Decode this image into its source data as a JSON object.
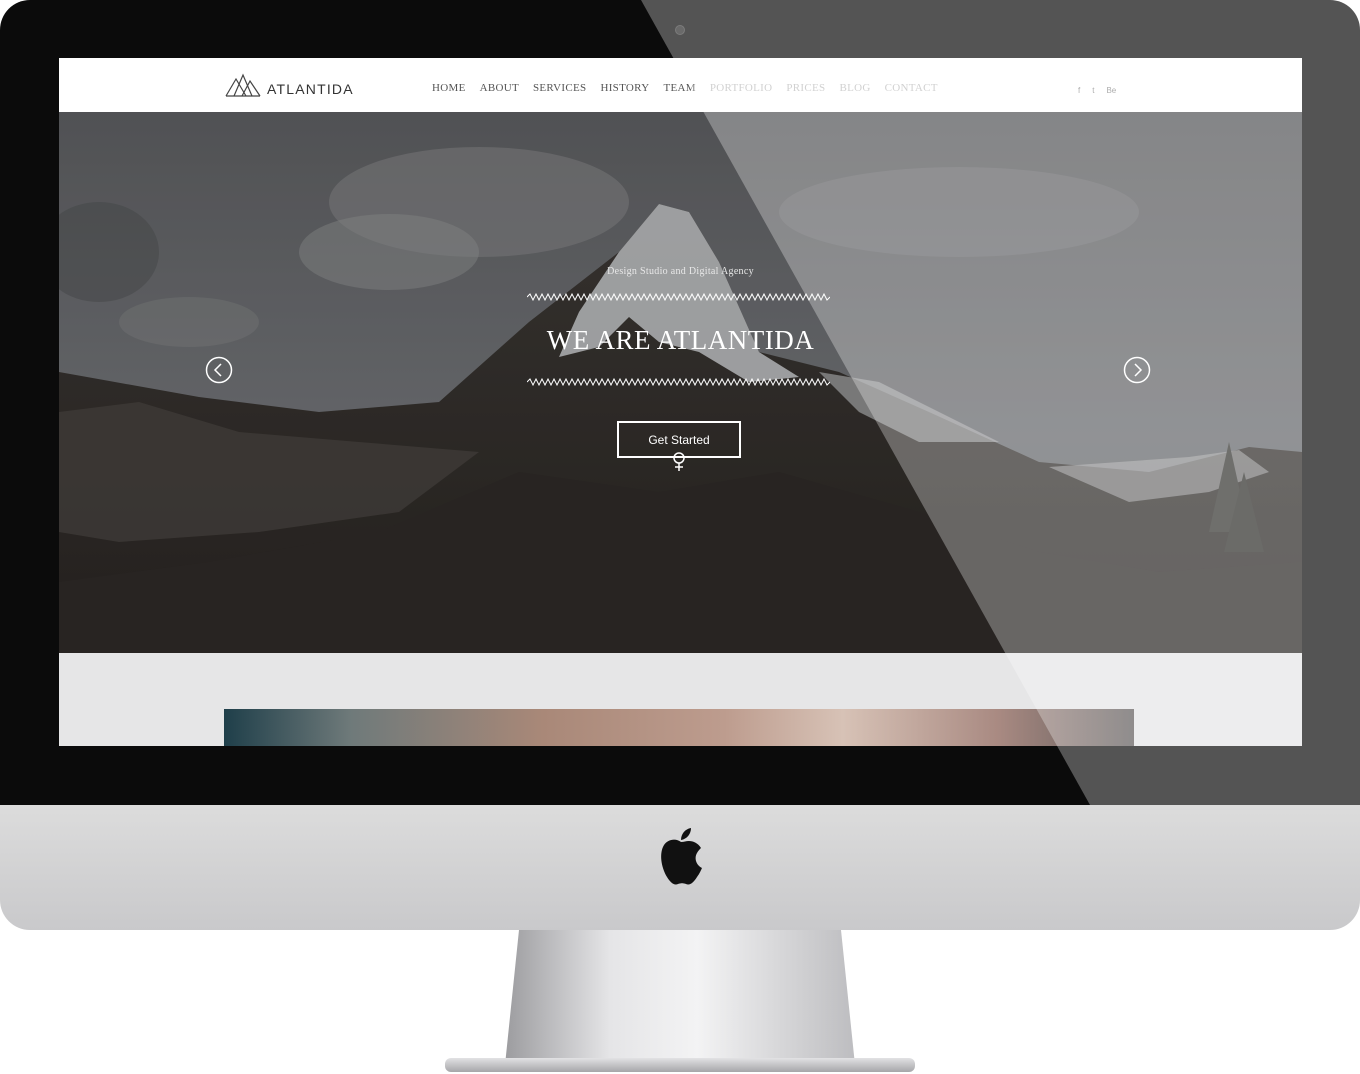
{
  "site": {
    "logo_text": "ATLANTIDA",
    "nav_items": [
      "HOME",
      "ABOUT",
      "SERVICES",
      "HISTORY",
      "TEAM",
      "PORTFOLIO",
      "PRICES",
      "BLOG",
      "CONTACT"
    ],
    "social_icons": [
      "facebook-icon",
      "twitter-icon",
      "behance-icon"
    ],
    "social_glyphs": [
      "f",
      "t",
      "Be"
    ]
  },
  "hero": {
    "subtitle": "Design Studio and Digital Agency",
    "headline": "WE ARE ATLANTIDA",
    "cta_label": "Get Started"
  },
  "colors": {
    "bezel": "#0b0b0b",
    "chin": "#d2d2d4",
    "nav_text": "#555555",
    "nav_text_dim": "#bdbdbd",
    "hero_text": "#ffffff"
  }
}
